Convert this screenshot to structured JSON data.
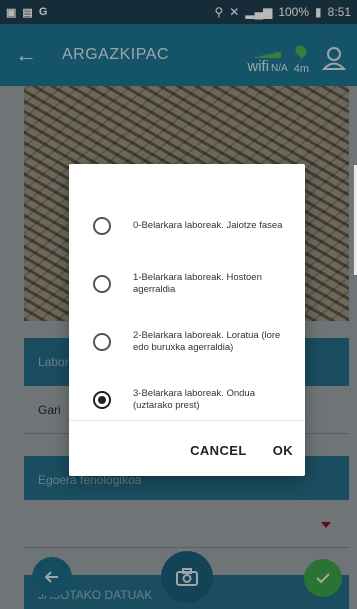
{
  "status_bar": {
    "left_icons": [
      "image-icon",
      "screen-icon",
      "G"
    ],
    "right_text": "100%",
    "time": "8:51"
  },
  "app_bar": {
    "title": "ARGAZKIPAC",
    "wifi_label": "wifi",
    "wifi_status": "N/A",
    "gps_value": "4m"
  },
  "background": {
    "section_crop_label": "Labor",
    "crop_value": "Gari",
    "phenology_label": "Egoera fenologikoa",
    "collected_data_label": "JASOTAKO DATUAK"
  },
  "dialog": {
    "options": [
      {
        "label": "0-Belarkara laboreak. Jaiotze fasea",
        "checked": false
      },
      {
        "label": "1-Belarkara laboreak. Hostoen agerraldia",
        "checked": false
      },
      {
        "label": "2-Belarkara laboreak. Loratua (lore edo buruxka agerraldia)",
        "checked": false
      },
      {
        "label": "3-Belarkara laboreak. Ondua (uztarako prest)",
        "checked": true
      }
    ],
    "cancel_label": "CANCEL",
    "ok_label": "OK"
  },
  "colors": {
    "app_bar": "#1d7391",
    "status_bar": "#1f3f50",
    "accent_green": "#3aa14a"
  }
}
